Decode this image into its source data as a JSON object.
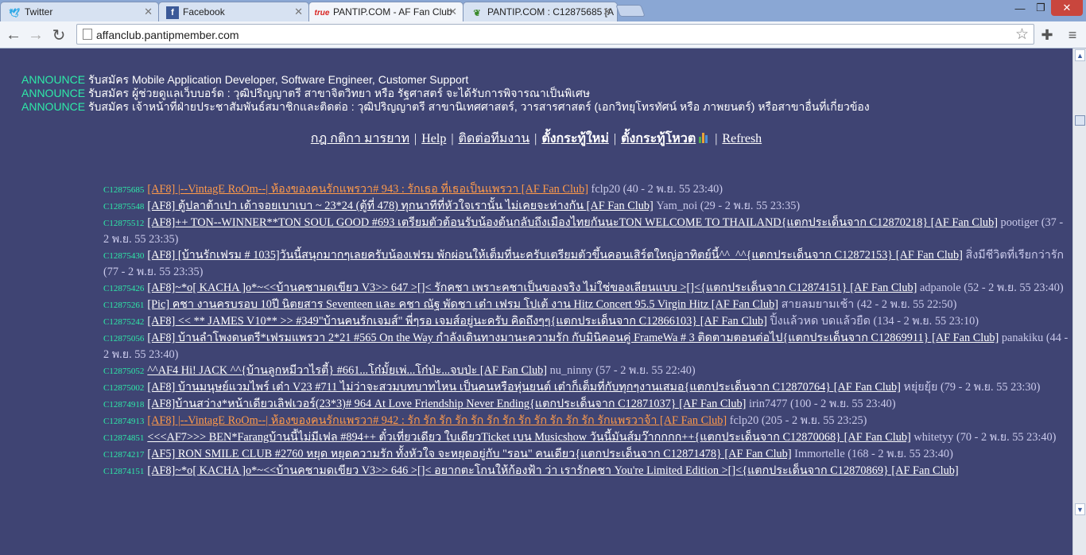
{
  "browser": {
    "tabs": [
      {
        "label": "Twitter",
        "favicon": "twitter-bird-icon"
      },
      {
        "label": "Facebook",
        "favicon": "facebook-icon"
      },
      {
        "label": "PANTIP.COM - AF Fan Club",
        "favicon": "true-logo-icon",
        "favicon_text": "true"
      },
      {
        "label": "PANTIP.COM : C12875685 [A",
        "favicon": "cactus-icon"
      }
    ],
    "url": "affanclub.pantipmember.com",
    "window_buttons": [
      "—",
      "❐",
      "✕"
    ]
  },
  "announcements": [
    {
      "keyword": "ANNOUNCE",
      "text": " รับสมัคร Mobile Application Developer, Software Engineer, Customer Support"
    },
    {
      "keyword": "ANNOUNCE",
      "text": " รับสมัคร ผู้ช่วยดูแลเว็บบอร์ด : วุฒิปริญญาตรี สาขาจิตวิทยา หรือ รัฐศาสตร์ จะได้รับการพิจารณาเป็นพิเศษ"
    },
    {
      "keyword": "ANNOUNCE",
      "text": " รับสมัคร เจ้าหน้าที่ฝ่ายประชาสัมพันธ์สมาชิกและติดต่อ : วุฒิปริญญาตรี สาขานิเทศศาสตร์, วารสารศาสตร์ (เอกวิทยุโทรทัศน์ หรือ ภาพยนตร์) หรือสาขาอื่นที่เกี่ยวข้อง"
    }
  ],
  "menu": {
    "rules": "กฎ กติกา มารยาท",
    "help": "Help",
    "contact": "ติดต่อทีมงาน",
    "new_topic": "ตั้งกระทู้ใหม่",
    "new_poll": "ตั้งกระทู้โหวต",
    "refresh": "Refresh",
    "separator": "|"
  },
  "topics": [
    {
      "id": "C12875685",
      "title": "[AF8] |--VintagE RoOm--| ห้องของคนรักแพรวา# 943 : รักเธอ ที่เธอเป็นแพรวา [AF Fan Club]",
      "meta": " fclp20 (40 - 2 พ.ย. 55 23:40)",
      "hot": true
    },
    {
      "id": "C12875548",
      "title": "[AF8] ตู้ปลาต้าเปา เต้าจอยเบาเบา ~ 23*24 (ตู้ที่ 478) ทุกนาทีที่หัวใจเรานั้น ไม่เคยจะห่างกัน [AF Fan Club]",
      "meta": " Yam_noi (29 - 2 พ.ย. 55 23:35)",
      "hot": false
    },
    {
      "id": "C12875512",
      "title": "[AF8]++ TON--WINNER**TON SOUL GOOD #693 เตรียมตัวต้อนรับน้องต้นกลับถึงเมืองไทยกันนะTON WELCOME TO THAILAND{แตกประเด็นจาก C12870218} [AF Fan Club]",
      "meta": " pootiger (37 - 2 พ.ย. 55 23:35)",
      "hot": false
    },
    {
      "id": "C12875430",
      "title": "[AF8] [บ้านรักเฟรม # 1035]วันนี้สนุกมากๆเลยครับน้องเฟรม พักผ่อนให้เต็มที่นะครับเตรียมตัวขึ้นคอนเสิร์ตใหญ่อาทิตย์นี้^^_^^{แตกประเด็นจาก C12872153} [AF Fan Club]",
      "meta": " สิ่งมีชีวิตที่เรียกว่ารัก (77 - 2 พ.ย. 55 23:35)",
      "hot": false
    },
    {
      "id": "C12875426",
      "title": "[AF8]~*o[ KACHA ]o*~<<บ้านคชามดเขียว V3>> 647 >[]< รักคชา เพราะคชาเป็นของจริง ไม่ใช่ของเลียนแบบ >[]<{แตกประเด็นจาก C12874151} [AF Fan Club]",
      "meta": " adpanole (52 - 2 พ.ย. 55 23:40)",
      "hot": false
    },
    {
      "id": "C12875261",
      "title": "[Pic] คชา งานครบรอบ 10ปี นิตยสาร Seventeen และ คชา ณัฐ พัดชา เต๋า เฟรม โปเต้ งาน Hitz Concert 95.5 Virgin Hitz [AF Fan Club]",
      "meta": " สายลมยามเช้า (42 - 2 พ.ย. 55 22:50)",
      "hot": false
    },
    {
      "id": "C12875242",
      "title": "[AF8] << ** JAMES V10** >> #349\"บ้านคนรักเจมส์\" พี่ๆรอ เจมส์อยู่นะครับ คิดถึงๆๆ{แตกประเด็นจาก C12866103} [AF Fan Club]",
      "meta": " ปิ้งแล้วหด บดแล้วยืด (134 - 2 พ.ย. 55 23:10)",
      "hot": false
    },
    {
      "id": "C12875056",
      "title": "[AF8] บ้านลำโพงดนตรี*เฟรมแพรวา 2*21 #565 On the Way กำลังเดินทางมานะความรัก กับมินิคอนคู่ FrameWa # 3 ติดตามตอนต่อไป{แตกประเด็นจาก C12869911} [AF Fan Club]",
      "meta": " panakiku (44 - 2 พ.ย. 55 23:40)",
      "hot": false
    },
    {
      "id": "C12875052",
      "title": "^^AF4 Hi! JACK ^^{บ้านลูกหมีวาไรตี้} #661...โก๋มั้ยเพ่...โก๋ป่ะ...จบป่ะ [AF Fan Club]",
      "meta": " nu_ninny (57 - 2 พ.ย. 55 22:40)",
      "hot": false
    },
    {
      "id": "C12875002",
      "title": "[AF8] บ้านมนุษย์แวมไพร์ เต๋า V23 #711 ไม่ว่าจะสวมบทบาทไหน เป็นคนหรือหุ่นยนต์ เต๋าก็เต็มที่กับทุกๆงานเสมอ{แตกประเด็นจาก C12870764} [AF Fan Club]",
      "meta": " หยุ่ยยุ้ย (79 - 2 พ.ย. 55 23:30)",
      "hot": false
    },
    {
      "id": "C12874918",
      "title": "[AF8]บ้านสว่าง*หน้าเดียวเลิฟเวอร์(23*3)# 964 At Love Friendship Never Ending{แตกประเด็นจาก C12871037} [AF Fan Club]",
      "meta": " irin7477 (100 - 2 พ.ย. 55 23:40)",
      "hot": false
    },
    {
      "id": "C12874913",
      "title": "[AF8] |--VintagE RoOm--| ห้องของคนรักแพรวา# 942 : รัก รัก รัก รัก รัก รัก รัก รัก รัก รัก รัก รัก รักแพรวาจ้า [AF Fan Club]",
      "meta": " fclp20 (205 - 2 พ.ย. 55 23:25)",
      "hot": true
    },
    {
      "id": "C12874851",
      "title": "<<<AF7>>> BEN*Farangบ้านนี้ไม่มีเฟล #894++ ตั๋วเที่ยวเดียว ใบเดียวTicket เบน Musicshow วันนี้มันส์มว๊ากกกก++{แตกประเด็นจาก C12870068} [AF Fan Club]",
      "meta": " whitetyy (70 - 2 พ.ย. 55 23:40)",
      "hot": false
    },
    {
      "id": "C12874217",
      "title": "[AF5] RON SMILE CLUB #2760 หยุด หยุดความรัก ทั้งหัวใจ จะหยุดอยู่กับ \"รอน\" คนเดียว{แตกประเด็นจาก C12871478} [AF Fan Club]",
      "meta": " Immortelle (168 - 2 พ.ย. 55 23:40)",
      "hot": false
    },
    {
      "id": "C12874151",
      "title": "[AF8]~*o[ KACHA ]o*~<<บ้านคชามดเขียว V3>> 646 >[]< อยากตะโกนให้ก้องฟ้า ว่า เรารักคชา You're Limited Edition >[]<{แตกประเด็นจาก C12870869} [AF Fan Club]",
      "meta": "",
      "hot": false
    }
  ],
  "colors": {
    "background": "#3f4473",
    "accent": "#2eeaa8",
    "hot_link": "#ff9a4a"
  }
}
